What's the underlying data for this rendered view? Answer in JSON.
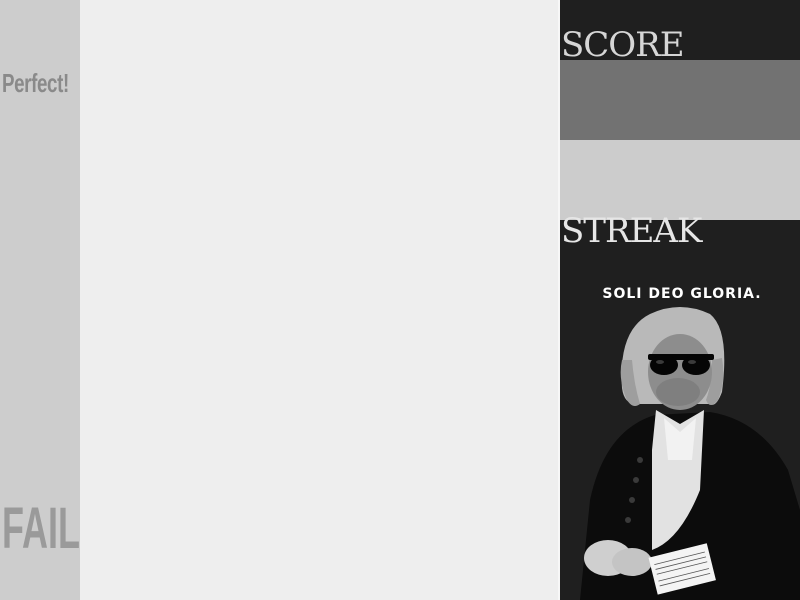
{
  "feedback": {
    "top_label": "Perfect!",
    "bottom_label": "FAIL"
  },
  "stats": {
    "score_label": "SCORE",
    "streak_label": "STREAK"
  },
  "sidebar": {
    "motto": "SOLI DEO GLORIA."
  },
  "colors": {
    "left_bar": "#cdcdcd",
    "playfield": "#eeeeee",
    "right_panel": "#1f1f1f",
    "score_box": "#727272",
    "streak_box": "#cccccc"
  },
  "icons": {
    "portrait": "composer-portrait-with-sunglasses"
  }
}
